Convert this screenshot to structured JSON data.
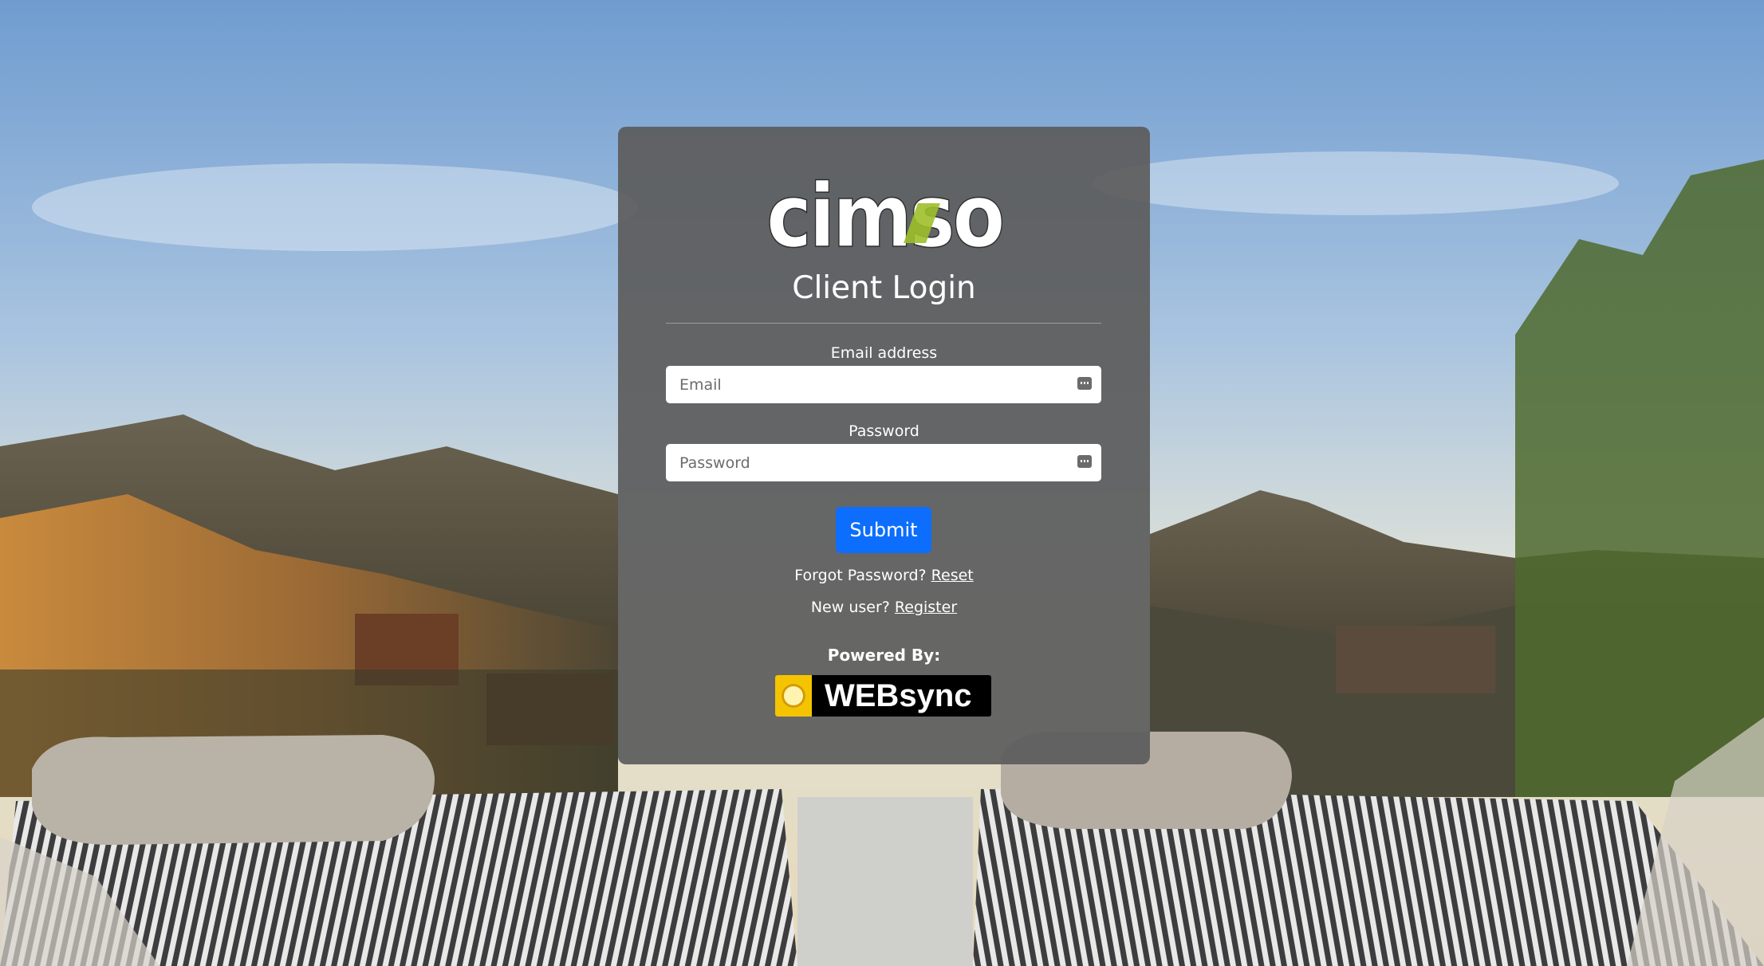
{
  "brand": {
    "logo_text": "cimso"
  },
  "login": {
    "title": "Client Login",
    "email_label": "Email address",
    "email_placeholder": "Email",
    "email_value": "",
    "password_label": "Password",
    "password_placeholder": "Password",
    "password_value": "",
    "submit_label": "Submit"
  },
  "links": {
    "forgot_text": "Forgot Password?",
    "reset_label": "Reset",
    "new_user_text": "New user?",
    "register_label": "Register"
  },
  "footer": {
    "powered_by": "Powered By:",
    "websync_text": "WEBsync"
  },
  "icons": {
    "email_field_icon": "password-manager-key-icon",
    "password_field_icon": "password-manager-key-icon",
    "websync_emblem": "globe-emblem-icon"
  },
  "colors": {
    "submit": "#0d6efd",
    "card": "#5c5c5c",
    "logo_accent": "#9dbf2a",
    "websync_emblem": "#f5c400"
  }
}
